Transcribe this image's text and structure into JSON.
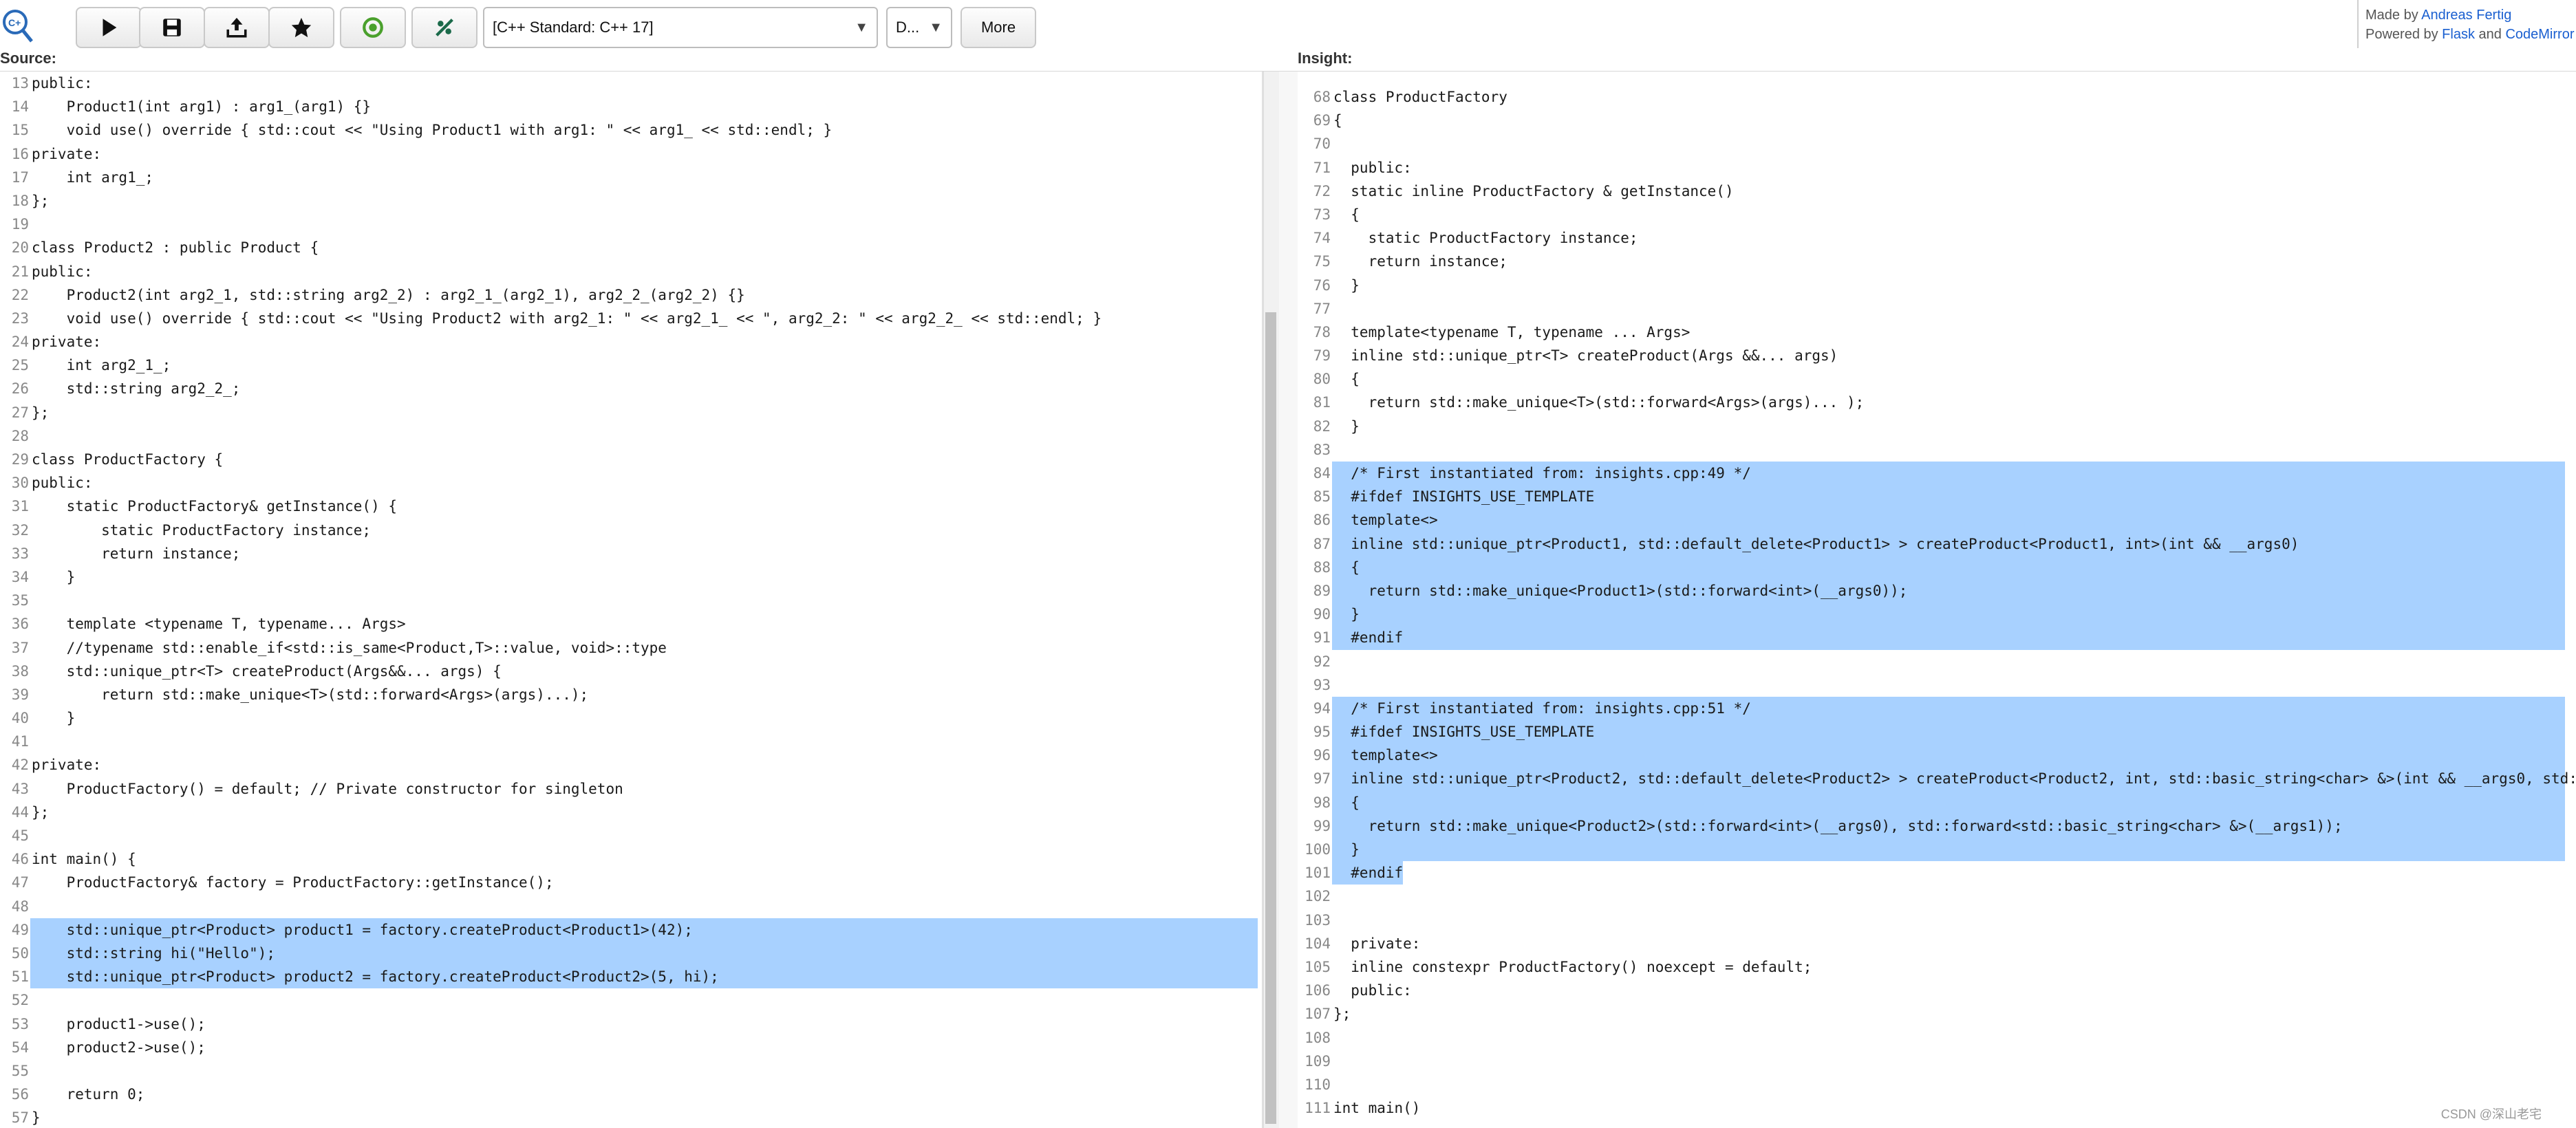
{
  "toolbar": {
    "logo_icon": "cppinsights-logo-icon",
    "buttons": [
      {
        "icon": "play-icon",
        "name": "run-button"
      },
      {
        "icon": "save-icon",
        "name": "save-button"
      },
      {
        "icon": "share-icon",
        "name": "share-button"
      },
      {
        "icon": "star-icon",
        "name": "favorite-button"
      },
      {
        "icon": "compiler-explorer-icon",
        "name": "compiler-explorer-button"
      },
      {
        "icon": "quickbench-icon",
        "name": "quickbench-button"
      }
    ],
    "standard_select": "[C++ Standard: C++ 17]",
    "option_select": "D...",
    "more_label": "More"
  },
  "credits": {
    "made_by_prefix": "Made by ",
    "author": "Andreas Fertig",
    "powered_by_prefix": "Powered by ",
    "flask": "Flask",
    "and": " and ",
    "codemirror": "CodeMirror"
  },
  "source": {
    "label": "Source:",
    "lines": [
      {
        "n": "13",
        "t": "public:"
      },
      {
        "n": "14",
        "t": "    Product1(int arg1) : arg1_(arg1) {}"
      },
      {
        "n": "15",
        "t": "    void use() override { std::cout << \"Using Product1 with arg1: \" << arg1_ << std::endl; }"
      },
      {
        "n": "16",
        "t": "private:"
      },
      {
        "n": "17",
        "t": "    int arg1_;"
      },
      {
        "n": "18",
        "t": "};"
      },
      {
        "n": "19",
        "t": ""
      },
      {
        "n": "20",
        "t": "class Product2 : public Product {"
      },
      {
        "n": "21",
        "t": "public:"
      },
      {
        "n": "22",
        "t": "    Product2(int arg2_1, std::string arg2_2) : arg2_1_(arg2_1), arg2_2_(arg2_2) {}"
      },
      {
        "n": "23",
        "t": "    void use() override { std::cout << \"Using Product2 with arg2_1: \" << arg2_1_ << \", arg2_2: \" << arg2_2_ << std::endl; }"
      },
      {
        "n": "24",
        "t": "private:"
      },
      {
        "n": "25",
        "t": "    int arg2_1_;"
      },
      {
        "n": "26",
        "t": "    std::string arg2_2_;"
      },
      {
        "n": "27",
        "t": "};"
      },
      {
        "n": "28",
        "t": ""
      },
      {
        "n": "29",
        "t": "class ProductFactory {"
      },
      {
        "n": "30",
        "t": "public:"
      },
      {
        "n": "31",
        "t": "    static ProductFactory& getInstance() {"
      },
      {
        "n": "32",
        "t": "        static ProductFactory instance;"
      },
      {
        "n": "33",
        "t": "        return instance;"
      },
      {
        "n": "34",
        "t": "    }"
      },
      {
        "n": "35",
        "t": ""
      },
      {
        "n": "36",
        "t": "    template <typename T, typename... Args>"
      },
      {
        "n": "37",
        "t": "    //typename std::enable_if<std::is_same<Product,T>::value, void>::type"
      },
      {
        "n": "38",
        "t": "    std::unique_ptr<T> createProduct(Args&&... args) {"
      },
      {
        "n": "39",
        "t": "        return std::make_unique<T>(std::forward<Args>(args)...);"
      },
      {
        "n": "40",
        "t": "    }"
      },
      {
        "n": "41",
        "t": ""
      },
      {
        "n": "42",
        "t": "private:"
      },
      {
        "n": "43",
        "t": "    ProductFactory() = default; // Private constructor for singleton"
      },
      {
        "n": "44",
        "t": "};"
      },
      {
        "n": "45",
        "t": ""
      },
      {
        "n": "46",
        "t": "int main() {"
      },
      {
        "n": "47",
        "t": "    ProductFactory& factory = ProductFactory::getInstance();"
      },
      {
        "n": "48",
        "t": ""
      },
      {
        "n": "49",
        "t": "    std::unique_ptr<Product> product1 = factory.createProduct<Product1>(42);",
        "hl": true
      },
      {
        "n": "50",
        "t": "    std::string hi(\"Hello\");",
        "hl": true
      },
      {
        "n": "51",
        "t": "    std::unique_ptr<Product> product2 = factory.createProduct<Product2>(5, hi);",
        "hl": true
      },
      {
        "n": "52",
        "t": ""
      },
      {
        "n": "53",
        "t": "    product1->use();"
      },
      {
        "n": "54",
        "t": "    product2->use();"
      },
      {
        "n": "55",
        "t": ""
      },
      {
        "n": "56",
        "t": "    return 0;"
      },
      {
        "n": "57",
        "t": "}"
      }
    ]
  },
  "insight": {
    "label": "Insight:",
    "lines": [
      {
        "n": "68",
        "t": "class ProductFactory"
      },
      {
        "n": "69",
        "t": "{"
      },
      {
        "n": "70",
        "t": ""
      },
      {
        "n": "71",
        "t": "  public:"
      },
      {
        "n": "72",
        "t": "  static inline ProductFactory & getInstance()"
      },
      {
        "n": "73",
        "t": "  {"
      },
      {
        "n": "74",
        "t": "    static ProductFactory instance;"
      },
      {
        "n": "75",
        "t": "    return instance;"
      },
      {
        "n": "76",
        "t": "  }"
      },
      {
        "n": "77",
        "t": ""
      },
      {
        "n": "78",
        "t": "  template<typename T, typename ... Args>"
      },
      {
        "n": "79",
        "t": "  inline std::unique_ptr<T> createProduct(Args &&... args)"
      },
      {
        "n": "80",
        "t": "  {"
      },
      {
        "n": "81",
        "t": "    return std::make_unique<T>(std::forward<Args>(args)... );"
      },
      {
        "n": "82",
        "t": "  }"
      },
      {
        "n": "83",
        "t": ""
      },
      {
        "n": "84",
        "t": "  /* First instantiated from: insights.cpp:49 */",
        "hl": true
      },
      {
        "n": "85",
        "t": "  #ifdef INSIGHTS_USE_TEMPLATE",
        "hl": true
      },
      {
        "n": "86",
        "t": "  template<>",
        "hl": true
      },
      {
        "n": "87",
        "t": "  inline std::unique_ptr<Product1, std::default_delete<Product1> > createProduct<Product1, int>(int && __args0)",
        "hl": true
      },
      {
        "n": "88",
        "t": "  {",
        "hl": true
      },
      {
        "n": "89",
        "t": "    return std::make_unique<Product1>(std::forward<int>(__args0));",
        "hl": true
      },
      {
        "n": "90",
        "t": "  }",
        "hl": true
      },
      {
        "n": "91",
        "t": "  #endif",
        "hl": true
      },
      {
        "n": "92",
        "t": "",
        "hl": true
      },
      {
        "n": "93",
        "t": "",
        "hl": true
      },
      {
        "n": "94",
        "t": "  /* First instantiated from: insights.cpp:51 */",
        "hl": true
      },
      {
        "n": "95",
        "t": "  #ifdef INSIGHTS_USE_TEMPLATE",
        "hl": true
      },
      {
        "n": "96",
        "t": "  template<>",
        "hl": true
      },
      {
        "n": "97",
        "t": "  inline std::unique_ptr<Product2, std::default_delete<Product2> > createProduct<Product2, int, std::basic_string<char> &>(int && __args0, std:",
        "hl": true
      },
      {
        "n": "98",
        "t": "  {",
        "hl": true
      },
      {
        "n": "99",
        "t": "    return std::make_unique<Product2>(std::forward<int>(__args0), std::forward<std::basic_string<char> &>(__args1));",
        "hl": true
      },
      {
        "n": "100",
        "t": "  }",
        "hl": true
      },
      {
        "n": "101",
        "t": "  #endif",
        "hlshort": true
      },
      {
        "n": "102",
        "t": ""
      },
      {
        "n": "103",
        "t": ""
      },
      {
        "n": "104",
        "t": "  private:"
      },
      {
        "n": "105",
        "t": "  inline constexpr ProductFactory() noexcept = default;"
      },
      {
        "n": "106",
        "t": "  public:"
      },
      {
        "n": "107",
        "t": "};"
      },
      {
        "n": "108",
        "t": ""
      },
      {
        "n": "109",
        "t": ""
      },
      {
        "n": "110",
        "t": ""
      },
      {
        "n": "111",
        "t": "int main()"
      }
    ]
  },
  "watermark": "CSDN @深山老宅"
}
